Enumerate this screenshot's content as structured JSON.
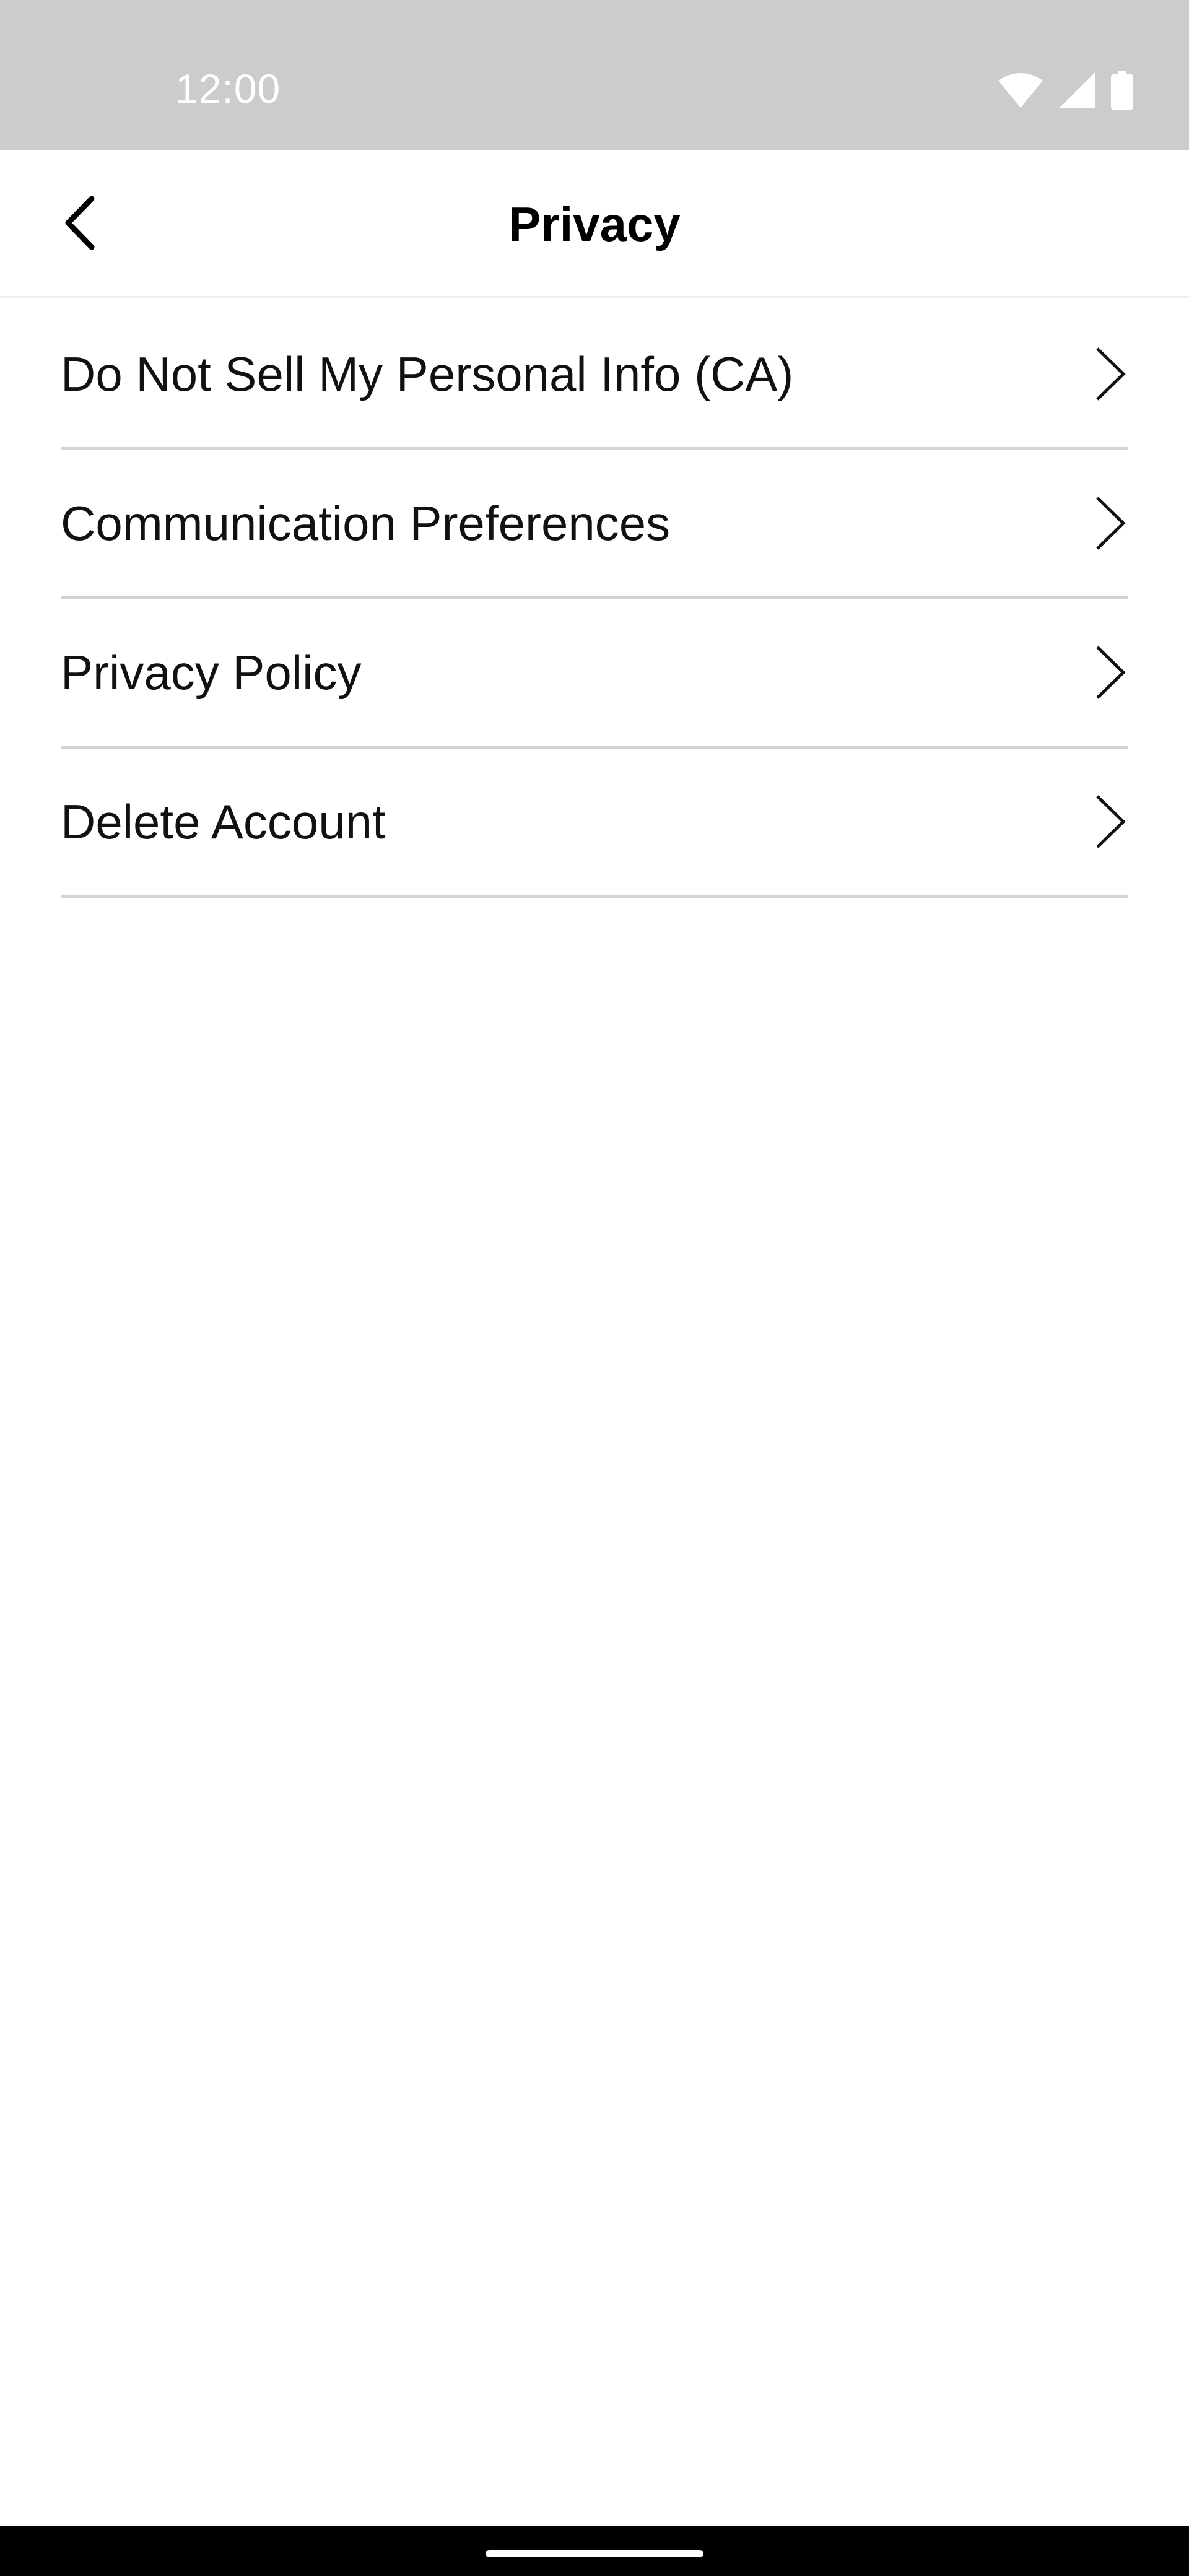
{
  "status_bar": {
    "time": "12:00",
    "icons": [
      "wifi-icon",
      "cellular-signal-icon",
      "battery-icon"
    ]
  },
  "header": {
    "title": "Privacy",
    "back_icon": "chevron-left-icon"
  },
  "menu": {
    "items": [
      {
        "label": "Do Not Sell My Personal Info (CA)",
        "icon": "chevron-right-icon"
      },
      {
        "label": "Communication Preferences",
        "icon": "chevron-right-icon"
      },
      {
        "label": "Privacy Policy",
        "icon": "chevron-right-icon"
      },
      {
        "label": "Delete Account",
        "icon": "chevron-right-icon"
      }
    ]
  },
  "colors": {
    "status_bar_bg": "#cccccc",
    "background": "#ffffff",
    "text": "#111111",
    "divider": "#d3d3d3",
    "nav_bar_bg": "#000000"
  }
}
